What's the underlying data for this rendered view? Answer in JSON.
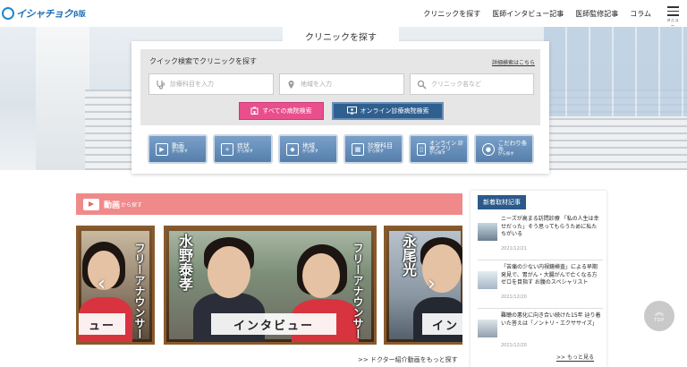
{
  "header": {
    "logo_text": "イシャチョク",
    "logo_sub": "β版",
    "nav": [
      "クリニックを探す",
      "医師インタビュー記事",
      "医師監修記事",
      "コラム"
    ],
    "menu_label": "メニュー"
  },
  "search": {
    "tab_label": "クリニックを探す",
    "quick_title": "クイック検索でクリニックを探す",
    "detail_link": "詳細検索はこちら",
    "fields": [
      {
        "placeholder": "診療科目を入力",
        "icon": "stethoscope-icon"
      },
      {
        "placeholder": "地域を入力",
        "icon": "map-pin-icon"
      },
      {
        "placeholder": "クリニック名など",
        "icon": "search-icon"
      }
    ],
    "btn_all": "すべての病院検索",
    "btn_online": "オンライン診療病院検索",
    "categories": [
      {
        "title": "動画",
        "sub": "から探す",
        "icon": "video-icon"
      },
      {
        "title": "症状",
        "sub": "から探す",
        "icon": "first-aid-icon"
      },
      {
        "title": "地域",
        "sub": "から探す",
        "icon": "map-icon"
      },
      {
        "title": "診療科目",
        "sub": "から探す",
        "icon": "grid-icon"
      },
      {
        "title": "オンライン 診療アプリ",
        "sub": "から探す",
        "icon": "phone-icon"
      },
      {
        "title": "こだわり条件",
        "sub": "から探す",
        "icon": "doctor-icon"
      }
    ]
  },
  "video": {
    "title": "動画",
    "title_sub": "から探す",
    "cards": [
      {
        "vtext": "フリーアナウンサー",
        "banner": "ュー"
      },
      {
        "name": "水野泰孝",
        "vtext": "フリーアナウンサー",
        "banner": "インタビュー"
      },
      {
        "name": "永尾光",
        "banner": "イン"
      }
    ],
    "more": ">> ドクター紹介動画をもっと探す"
  },
  "news": {
    "tag": "新着取材記事",
    "items": [
      {
        "title": "ニーズが高まる訪問診療 「私の人生は幸せだった」そう思ってもらうために私たちがいる",
        "date": "2021/12/21"
      },
      {
        "title": "「苦痛の少ない内視鏡検査」による早期発見で、胃がん・大腸がんで亡くなる方ゼロを目指す お腹のスペシャリスト",
        "date": "2021/12/20"
      },
      {
        "title": "難聴の悪化に向き合い続けた15年 辿り着いた答えは「ノントリ・エクササイズ」",
        "date": "2021/12/20"
      }
    ],
    "more": ">> もっと見る"
  },
  "top_button": "TOP"
}
